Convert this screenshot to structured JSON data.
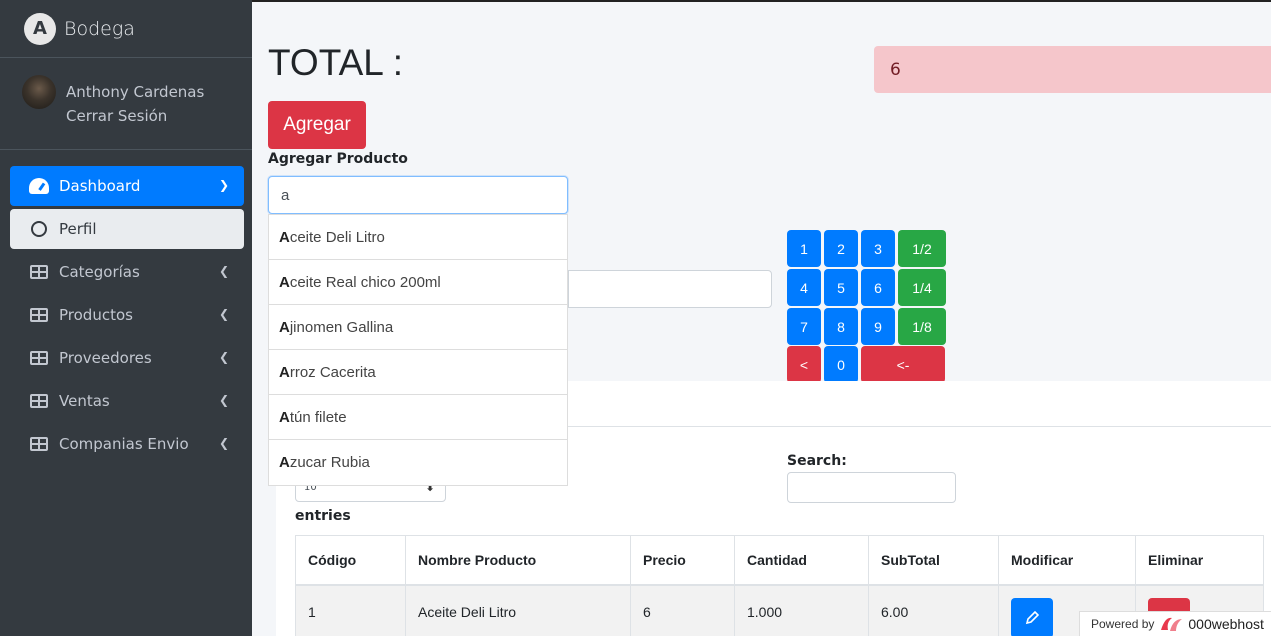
{
  "brand": {
    "name": "Bodega"
  },
  "user": {
    "name": "Anthony Cardenas",
    "logout": "Cerrar Sesión"
  },
  "sidebar": {
    "items": [
      {
        "label": "Dashboard",
        "icon": "tachometer-icon"
      },
      {
        "label": "Perfil",
        "icon": "circle-icon"
      },
      {
        "label": "Categorías",
        "icon": "table-icon"
      },
      {
        "label": "Productos",
        "icon": "table-icon"
      },
      {
        "label": "Proveedores",
        "icon": "table-icon"
      },
      {
        "label": "Ventas",
        "icon": "table-icon"
      },
      {
        "label": "Companias Envio",
        "icon": "table-icon"
      }
    ]
  },
  "total": {
    "label": "TOTAL :",
    "value": "6"
  },
  "form": {
    "add_button": "Agregar",
    "product_label": "Agregar Producto",
    "search_value": "a"
  },
  "autocomplete": [
    {
      "match": "A",
      "rest": "ceite Deli Litro"
    },
    {
      "match": "A",
      "rest": "ceite Real chico 200ml"
    },
    {
      "match": "A",
      "rest": "jinomen Gallina"
    },
    {
      "match": "A",
      "rest": "rroz Cacerita"
    },
    {
      "match": "A",
      "rest": "tún filete"
    },
    {
      "match": "A",
      "rest": "zucar Rubia"
    }
  ],
  "keypad": {
    "keys": [
      "1",
      "2",
      "3",
      "1/2",
      "4",
      "5",
      "6",
      "1/4",
      "7",
      "8",
      "9",
      "1/8",
      "<",
      "0",
      "<-"
    ]
  },
  "table": {
    "length_value": "10",
    "entries_label": "entries",
    "search_label": "Search:",
    "headers": [
      "Código",
      "Nombre Producto",
      "Precio",
      "Cantidad",
      "SubTotal",
      "Modificar",
      "Eliminar"
    ],
    "rows": [
      {
        "codigo": "1",
        "nombre": "Aceite Deli Litro",
        "precio": "6",
        "cantidad": "1.000",
        "subtotal": "6.00"
      }
    ]
  },
  "footer": {
    "powered": "Powered by",
    "host": "000webhost"
  },
  "colors": {
    "primary": "#007bff",
    "danger": "#dc3545",
    "success": "#28a745",
    "sidebar": "#343a40"
  }
}
